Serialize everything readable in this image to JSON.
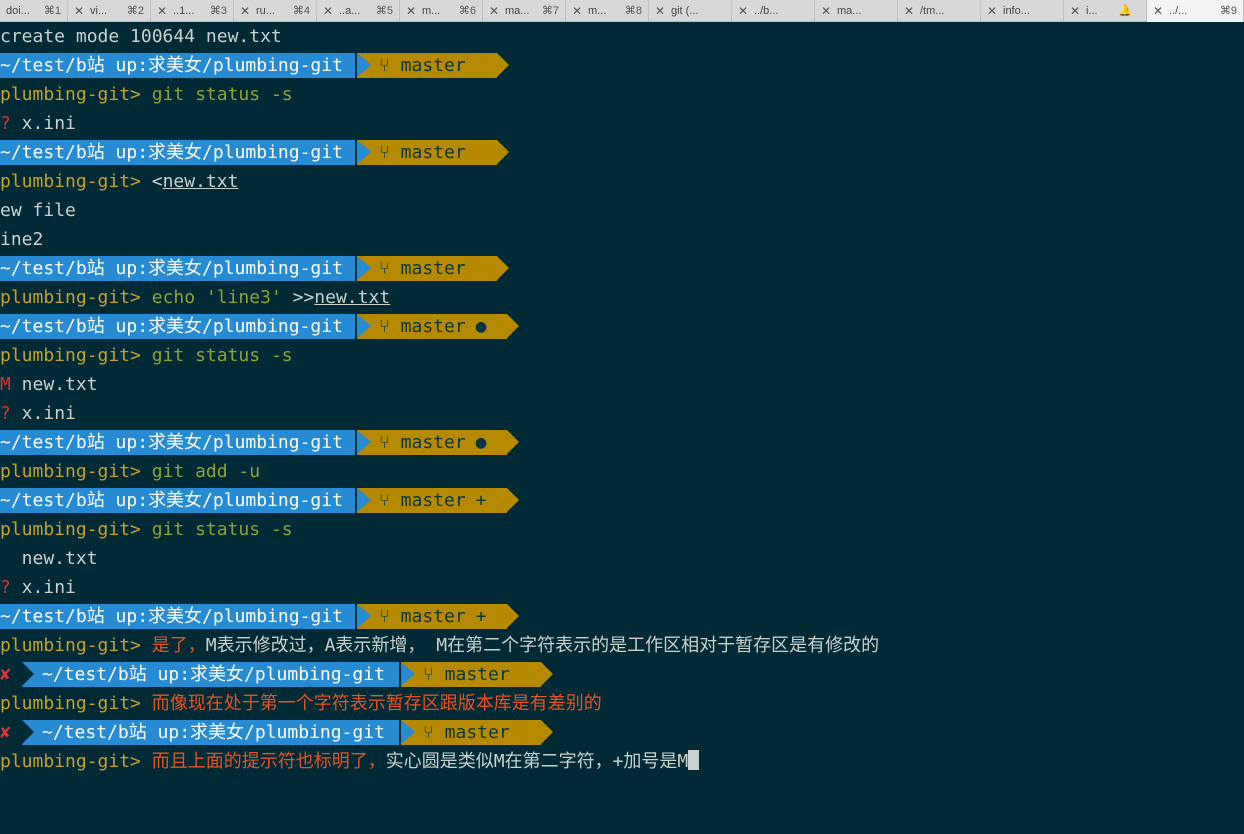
{
  "tabs": [
    {
      "title": "doi...",
      "key": "⌘1"
    },
    {
      "title": "vi...",
      "key": "⌘2"
    },
    {
      "title": "..1...",
      "key": "⌘3"
    },
    {
      "title": "ru...",
      "key": "⌘4"
    },
    {
      "title": "..a...",
      "key": "⌘5"
    },
    {
      "title": "m...",
      "key": "⌘6"
    },
    {
      "title": "ma...",
      "key": "⌘7"
    },
    {
      "title": "m...",
      "key": "⌘8"
    },
    {
      "title": "git (...",
      "key": ""
    },
    {
      "title": "../b...",
      "key": ""
    },
    {
      "title": "ma...",
      "key": ""
    },
    {
      "title": "/tm...",
      "key": ""
    },
    {
      "title": "info...",
      "key": ""
    },
    {
      "title": "i...",
      "key": ""
    },
    {
      "title": "../...",
      "key": "⌘9"
    }
  ],
  "prompt": {
    "path": "~/test/b站 up:求美女/plumbing-git",
    "branch": "master",
    "repo": "plumbing-git>",
    "error_mark": "✘",
    "dirty_mark": "●",
    "staged_mark": "+"
  },
  "lines": {
    "l0": "create mode 100644 new.txt",
    "l2_cmd": "git status -s",
    "l3_mark": "?",
    "l3_file": " x.ini",
    "l5_cmd_lt": "<",
    "l5_cmd_file": "new.txt",
    "l6": "ew file",
    "l7": "ine2",
    "l9_cmd": "echo 'line3'",
    "l9_op": " >>",
    "l9_file": "new.txt",
    "l11_cmd": "git status -s",
    "l12_mark": "M",
    "l12_file": " new.txt",
    "l13_mark": "?",
    "l13_file": " x.ini",
    "l15_cmd": "git add -u",
    "l17_cmd": "git status -s",
    "l18": "  new.txt",
    "l19_mark": "?",
    "l19_file": " x.ini",
    "l21_red": "是了，",
    "l21_rest": "M表示修改过，A表示新增， M在第二个字符表示的是工作区相对于暂存区是有修改的",
    "l23_text": "而像现在处于第一个字符表示暂存区跟版本库是有差别的",
    "l25_red": "而且上面的提示符也标明了，",
    "l25_rest": "实心圆是类似M在第二字符，+加号是M"
  }
}
